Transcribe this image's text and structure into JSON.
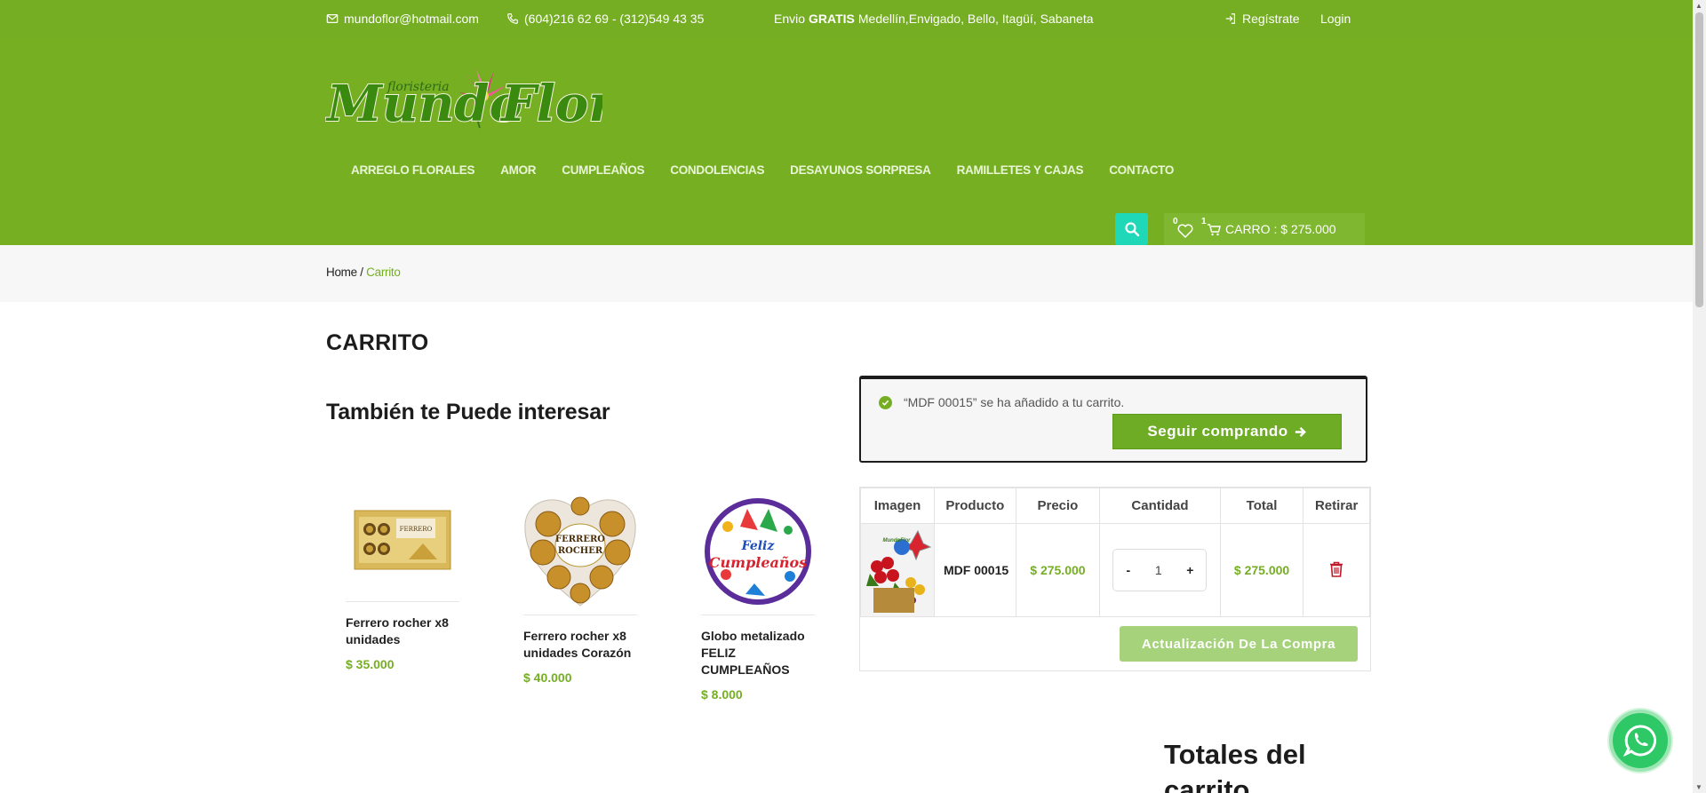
{
  "topbar": {
    "email": "mundoflor@hotmail.com",
    "phone": "(604)216 62 69 - (312)549 43 35",
    "shipping_prefix": "Envio",
    "shipping_bold": "GRATIS",
    "shipping_cities": "Medellín,Envigado, Bello, Itagüí, Sabaneta",
    "register": "Regístrate",
    "login": "Login"
  },
  "logo": {
    "small": "floristeria",
    "main": "Mundo Flor"
  },
  "nav": [
    "ARREGLO FLORALES",
    "AMOR",
    "CUMPLEAÑOS",
    "CONDOLENCIAS",
    "DESAYUNOS SORPRESA",
    "RAMILLETES Y CAJAS",
    "CONTACTO"
  ],
  "header_tools": {
    "wishlist_count": "0",
    "cart_count": "1",
    "cart_label": "CARRO : $ 275.000"
  },
  "breadcrumb": {
    "home": "Home",
    "sep": " / ",
    "current": "Carrito"
  },
  "page_title": "CARRITO",
  "related": {
    "title": "También te Puede interesar",
    "products": [
      {
        "name": "Ferrero rocher x8 unidades",
        "price": "$ 35.000"
      },
      {
        "name": "Ferrero rocher x8 unidades Corazón",
        "price": "$ 40.000"
      },
      {
        "name": "Globo metalizado FELIZ CUMPLEAÑOS",
        "price": "$ 8.000"
      }
    ]
  },
  "notice": {
    "message": "“MDF 00015” se ha añadido a tu carrito.",
    "button": "Seguir comprando"
  },
  "cart_table": {
    "headers": [
      "Imagen",
      "Producto",
      "Precio",
      "Cantidad",
      "Total",
      "Retirar"
    ],
    "row": {
      "product": "MDF 00015",
      "price": "$ 275.000",
      "qty": "1",
      "total": "$ 275.000"
    },
    "minus": "-",
    "plus": "+",
    "update_button": "Actualización De La Compra"
  },
  "totals_title": "Totales del carrito",
  "colors": {
    "brand_green": "#75ae23",
    "price_green": "#75ae23",
    "search_teal": "#1fd8b8",
    "remove_red": "#c0182a",
    "whatsapp": "#2ec866"
  },
  "icons": [
    "mail-icon",
    "phone-icon",
    "register-icon",
    "search-icon",
    "heart-icon",
    "cart-icon",
    "check-icon",
    "arrow-right-icon",
    "trash-icon",
    "whatsapp-icon"
  ]
}
